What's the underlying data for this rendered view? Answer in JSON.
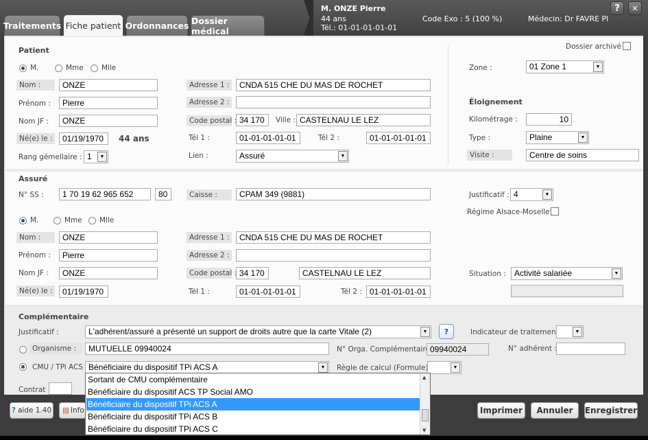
{
  "tabs": [
    "Traitements",
    "Fiche patient",
    "Ordonnances",
    "Dossier médical"
  ],
  "header": {
    "patient_name": "M. ONZE Pierre",
    "age": "44 ans",
    "tel": "Tél.: 01-01-01-01-01",
    "code_exo": "Code Exo : 5 (100 %)",
    "medecin": "Médecin: Dr FAVRE Pl",
    "help_btn": "?",
    "close_btn": "✕"
  },
  "patient": {
    "title": "Patient",
    "civilite": [
      "M.",
      "Mme",
      "Mlle"
    ],
    "nom_label": "Nom :",
    "nom": "ONZE",
    "prenom_label": "Prénom :",
    "prenom": "Pierre",
    "nomjf_label": "Nom JF :",
    "nomjf": "ONZE",
    "ne_label": "Né(e) le :",
    "ne": "01/19/1970",
    "age": "44 ans",
    "rang_label": "Rang gémellaire :",
    "rang": "1",
    "adresse1_label": "Adresse 1 :",
    "adresse1": "CNDA 515 CHE DU MAS DE ROCHET",
    "adresse2_label": "Adresse 2 :",
    "adresse2": "",
    "cp_label": "Code postal :",
    "cp": "34 170",
    "ville_label": "Ville :",
    "ville": "CASTELNAU LE LEZ",
    "tel1_label": "Tél 1 :",
    "tel1": "01-01-01-01-01",
    "tel2_label": "Tél 2 :",
    "tel2": "01-01-01-01-01",
    "lien_label": "Lien :",
    "lien": "Assuré"
  },
  "right_panel": {
    "archive_label": "Dossier archivé",
    "zone_label": "Zone :",
    "zone": "01  Zone 1",
    "eloignement_title": "Éloignement",
    "km_label": "Kilométrage :",
    "km": "10",
    "type_label": "Type :",
    "type": "Plaine",
    "visite_label": "Visite :",
    "visite": "Centre de soins"
  },
  "assure": {
    "title": "Assuré",
    "ss_label": "N° SS :",
    "ss": "1 70 19 62 965 652",
    "ss_key": "80",
    "caisse_label": "Caisse :",
    "caisse": "CPAM 349 (9881)",
    "justificatif_label": "Justificatif :",
    "justificatif": "4",
    "alsace_label": "Régime Alsace-Moselle",
    "civilite": [
      "M.",
      "Mme",
      "Mlle"
    ],
    "nom_label": "Nom :",
    "nom": "ONZE",
    "prenom_label": "Prénom :",
    "prenom": "Pierre",
    "nomjf_label": "Nom JF :",
    "nomjf": "ONZE",
    "ne_label": "Né(e) le :",
    "ne": "01/19/1970",
    "adresse1_label": "Adresse 1 :",
    "adresse1": "CNDA 515 CHE DU MAS DE ROCHET",
    "adresse2_label": "Adresse 2 :",
    "adresse2": "",
    "cp_label": "Code postal :",
    "cp": "34 170",
    "ville": "CASTELNAU LE LEZ",
    "tel1_label": "Tél 1 :",
    "tel1": "01-01-01-01-01",
    "tel2_label": "Tél 2 :",
    "tel2": "01-01-01-01-01",
    "situation_label": "Situation :",
    "situation": "Activité salariée"
  },
  "complementaire": {
    "title": "Complémentaire",
    "justificatif_label": "Justificatif :",
    "justificatif": "L'adhérent/assuré a présenté un support de droits autre que la carte Vitale (2)",
    "indicateur_label": "Indicateur de traitement :",
    "organisme_label": "Organisme :",
    "organisme": "MUTUELLE 09940024",
    "norga_label": "N° Orga. Complémentaire :",
    "norga": "09940024",
    "nadherent_label": "N° adhérent :",
    "cmu_label": "CMU / TPi ACS :",
    "cmu": "Bénéficiaire du dispositif TPi ACS A",
    "regle_label": "Règle de calcul (Formule) :",
    "contrat_label": "Contrat :"
  },
  "dropdown_options": [
    "Sortant de CMU complémentaire",
    "Bénéficiaire du dispositif ACS TP Social AMO",
    "Bénéficiaire du dispositif TPi ACS A",
    "Bénéficiaire du dispositif TPi ACS B",
    "Bénéficiaire du dispositif TPi ACS C"
  ],
  "footer": {
    "aide": "aide 1.40",
    "info": "Info",
    "imprimer": "Imprimer",
    "annuler": "Annuler",
    "enregistrer": "Enregistrer"
  }
}
